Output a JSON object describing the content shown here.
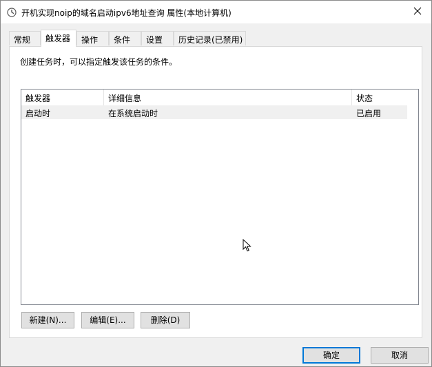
{
  "window": {
    "title": "开机实现noip的域名启动ipv6地址查询 属性(本地计算机)"
  },
  "tabs": [
    {
      "label": "常规"
    },
    {
      "label": "触发器"
    },
    {
      "label": "操作"
    },
    {
      "label": "条件"
    },
    {
      "label": "设置"
    },
    {
      "label": "历史记录(已禁用)"
    }
  ],
  "active_tab": "触发器",
  "triggers": {
    "description": "创建任务时，可以指定触发该任务的条件。",
    "columns": [
      "触发器",
      "详细信息",
      "状态"
    ],
    "rows": [
      {
        "trigger": "启动时",
        "details": "在系统启动时",
        "status": "已启用"
      }
    ],
    "buttons": {
      "new": "新建(N)...",
      "edit": "编辑(E)...",
      "delete": "删除(D)"
    }
  },
  "footer": {
    "ok": "确定",
    "cancel": "取消"
  },
  "colors": {
    "accent": "#0078d7",
    "selected_row": "#f0f0f0"
  },
  "icons": {
    "title": "clock-icon",
    "close": "close-icon",
    "cursor": "mouse-pointer-icon"
  }
}
